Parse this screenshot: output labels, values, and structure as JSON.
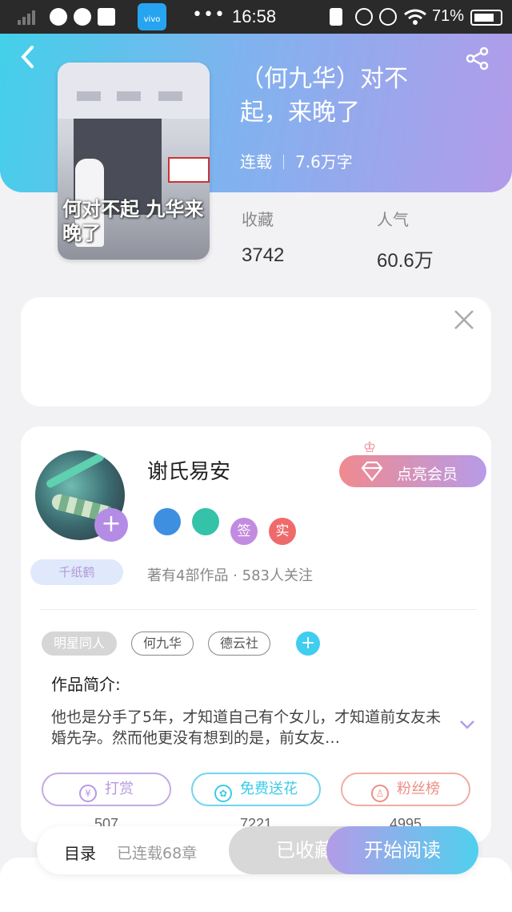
{
  "status_bar": {
    "time": "16:58",
    "battery": "71%",
    "vivo_label": "vivo",
    "dots": "•••"
  },
  "header": {
    "back_icon": "chevron-left-icon",
    "share_icon": "share-icon",
    "cover_caption": "何对不起 九华来晚了",
    "title": "（何九华）对不起，来晚了",
    "status": "连载",
    "word_count": "7.6万字",
    "stats": [
      {
        "label": "收藏",
        "value": "3742"
      },
      {
        "label": "人气",
        "value": "60.6万"
      }
    ]
  },
  "ad_card": {
    "close_icon": "close-icon"
  },
  "author": {
    "name": "谢氏易安",
    "badge": "千纸鹤",
    "vip_button": "点亮会员",
    "badge_icons": [
      {
        "name": "phone-badge-icon",
        "text": "",
        "color": "#3f8fe0"
      },
      {
        "name": "handshake-badge-icon",
        "text": "",
        "color": "#34c2a8"
      },
      {
        "name": "sign-badge-icon",
        "text": "签",
        "color": "#c28be0"
      },
      {
        "name": "verified-badge-icon",
        "text": "实",
        "color": "#ef6b6b"
      }
    ],
    "works": "著有4部作品 · 583人关注"
  },
  "tags": [
    "明星同人",
    "何九华",
    "德云社"
  ],
  "intro": {
    "heading": "作品简介:",
    "text": "他也是分手了5年，才知道自己有个女儿，才知道前女友未婚先孕。然而他更没有想到的是，前女友…"
  },
  "actions": [
    {
      "label": "打赏",
      "count": "507",
      "icon": "¥",
      "color": "#b89ae0"
    },
    {
      "label": "免费送花",
      "count": "7221",
      "icon": "✿",
      "color": "#3ccbe8"
    },
    {
      "label": "粉丝榜",
      "count": "4995",
      "icon": "♙",
      "color": "#ec8f86"
    }
  ],
  "bottom_bar": {
    "toc": "目录",
    "chapters": "已连载68章",
    "collected": "已收藏",
    "read": "开始阅读"
  }
}
